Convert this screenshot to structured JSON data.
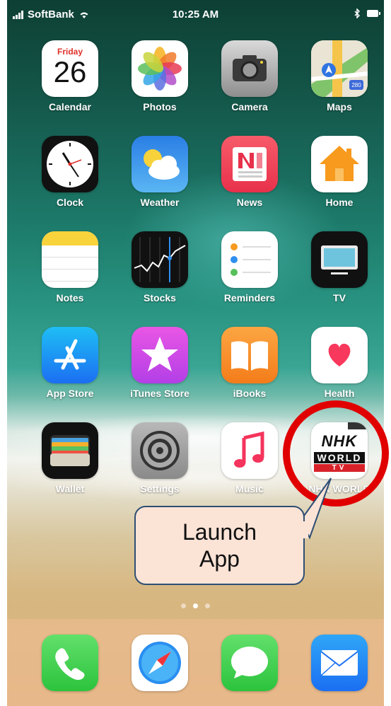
{
  "status_bar": {
    "carrier": "SoftBank",
    "time": "10:25 AM"
  },
  "calendar": {
    "weekday": "Friday",
    "day": "26"
  },
  "maps_shield": "280",
  "apps": [
    {
      "label": "Calendar",
      "icon": "calendar-icon"
    },
    {
      "label": "Photos",
      "icon": "photos-icon"
    },
    {
      "label": "Camera",
      "icon": "camera-icon"
    },
    {
      "label": "Maps",
      "icon": "maps-icon"
    },
    {
      "label": "Clock",
      "icon": "clock-icon"
    },
    {
      "label": "Weather",
      "icon": "weather-icon"
    },
    {
      "label": "News",
      "icon": "news-icon"
    },
    {
      "label": "Home",
      "icon": "home-icon"
    },
    {
      "label": "Notes",
      "icon": "notes-icon"
    },
    {
      "label": "Stocks",
      "icon": "stocks-icon"
    },
    {
      "label": "Reminders",
      "icon": "reminders-icon"
    },
    {
      "label": "TV",
      "icon": "tv-icon"
    },
    {
      "label": "App Store",
      "icon": "app-store-icon"
    },
    {
      "label": "iTunes Store",
      "icon": "itunes-store-icon"
    },
    {
      "label": "iBooks",
      "icon": "ibooks-icon"
    },
    {
      "label": "Health",
      "icon": "health-icon"
    },
    {
      "label": "Wallet",
      "icon": "wallet-icon"
    },
    {
      "label": "Settings",
      "icon": "settings-icon"
    },
    {
      "label": "Music",
      "icon": "music-icon"
    },
    {
      "label": "NHK WORLD",
      "icon": "nhk-world-icon"
    }
  ],
  "nhk_logo": {
    "line1": "NHK",
    "line2": "WORLD",
    "line3": "TV"
  },
  "dock": [
    {
      "name": "Phone",
      "icon": "phone-icon"
    },
    {
      "name": "Safari",
      "icon": "safari-icon"
    },
    {
      "name": "Messages",
      "icon": "messages-icon"
    },
    {
      "name": "Mail",
      "icon": "mail-icon"
    }
  ],
  "callout": {
    "line1": "Launch",
    "line2": "App"
  },
  "colors": {
    "highlight_ring": "#e00000",
    "callout_fill": "#fbe3d6",
    "callout_border": "#2e4e74"
  }
}
